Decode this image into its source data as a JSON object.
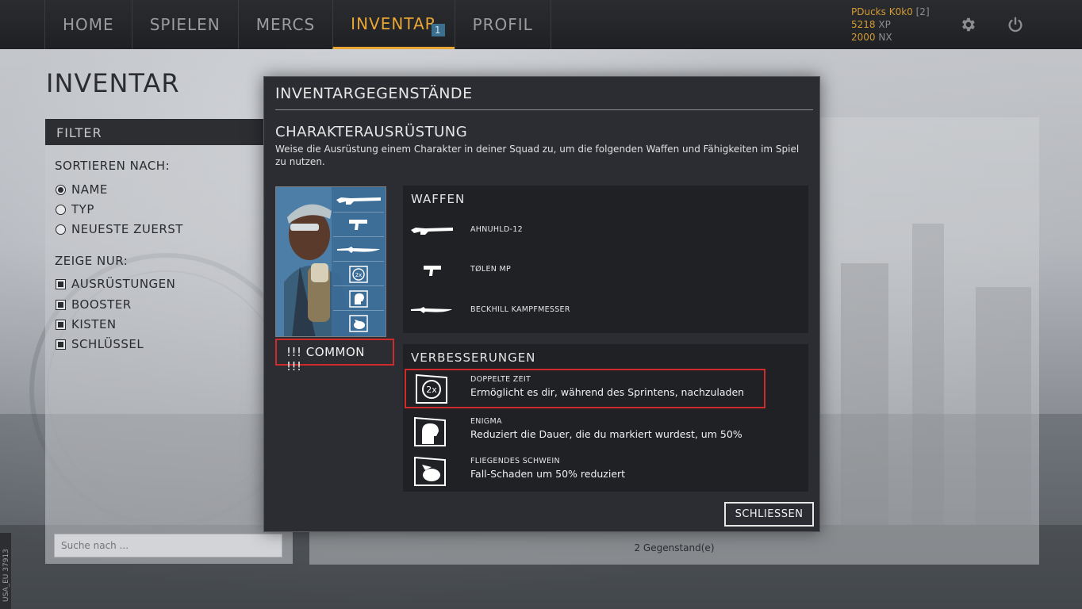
{
  "nav": {
    "items": [
      {
        "label": "HOME"
      },
      {
        "label": "SPIELEN"
      },
      {
        "label": "MERCS"
      },
      {
        "label": "INVENTAR",
        "badge": "1",
        "active": true
      },
      {
        "label": "PROFIL"
      }
    ]
  },
  "user": {
    "name": "PDucks K0k0",
    "level": "[2]",
    "xp_value": "5218",
    "xp_unit": "XP",
    "nx_value": "2000",
    "nx_unit": "NX",
    "icons": [
      "gear-icon",
      "power-icon"
    ]
  },
  "page": {
    "title": "INVENTAR"
  },
  "filter": {
    "header": "FILTER",
    "sort_label": "SORTIEREN NACH:",
    "sort_options": [
      {
        "label": "NAME",
        "checked": true
      },
      {
        "label": "TYP",
        "checked": false
      },
      {
        "label": "NEUESTE ZUERST",
        "checked": false
      }
    ],
    "show_label": "ZEIGE NUR:",
    "show_options": [
      {
        "label": "AUSRÜSTUNGEN",
        "checked": true
      },
      {
        "label": "BOOSTER",
        "checked": true
      },
      {
        "label": "KISTEN",
        "checked": true
      },
      {
        "label": "SCHLÜSSEL",
        "checked": true
      }
    ],
    "search_placeholder": "Suche nach ..."
  },
  "items_panel": {
    "count_text": "2 Gegenstand(e)"
  },
  "modal": {
    "title": "INVENTARGEGENSTÄNDE",
    "section_title": "CHARAKTERAUSRÜSTUNG",
    "section_desc": "Weise die Ausrüstung einem Charakter in deiner Squad zu, um die folgenden Waffen und Fähigkeiten im Spiel zu nutzen.",
    "rarity_label": "!!! COMMON !!!",
    "weapons_title": "WAFFEN",
    "weapons": [
      {
        "name": "AHNUHLD-12",
        "icon": "shotgun-icon"
      },
      {
        "name": "TØLEN MP",
        "icon": "smg-icon"
      },
      {
        "name": "BECKHILL KAMPFMESSER",
        "icon": "knife-icon"
      }
    ],
    "upgrades_title": "VERBESSERUNGEN",
    "upgrades": [
      {
        "name": "DOPPELTE ZEIT",
        "desc": "Ermöglicht es dir, während des Sprintens, nachzuladen",
        "icon": "double-time-icon",
        "highlighted": true
      },
      {
        "name": "ENIGMA",
        "desc": "Reduziert die Dauer, die du markiert wurdest, um 50%",
        "icon": "enigma-icon",
        "highlighted": false
      },
      {
        "name": "FLIEGENDES SCHWEIN",
        "desc": "Fall-Schaden um 50% reduziert",
        "icon": "flying-pig-icon",
        "highlighted": false
      }
    ],
    "close_label": "SCHLIESSEN"
  },
  "server_tag": "USA_EU 37913",
  "colors": {
    "accent": "#e8a634",
    "highlight_red": "#cf2b2b",
    "modal_bg": "#2b2d33",
    "box_bg": "#1f2125"
  }
}
